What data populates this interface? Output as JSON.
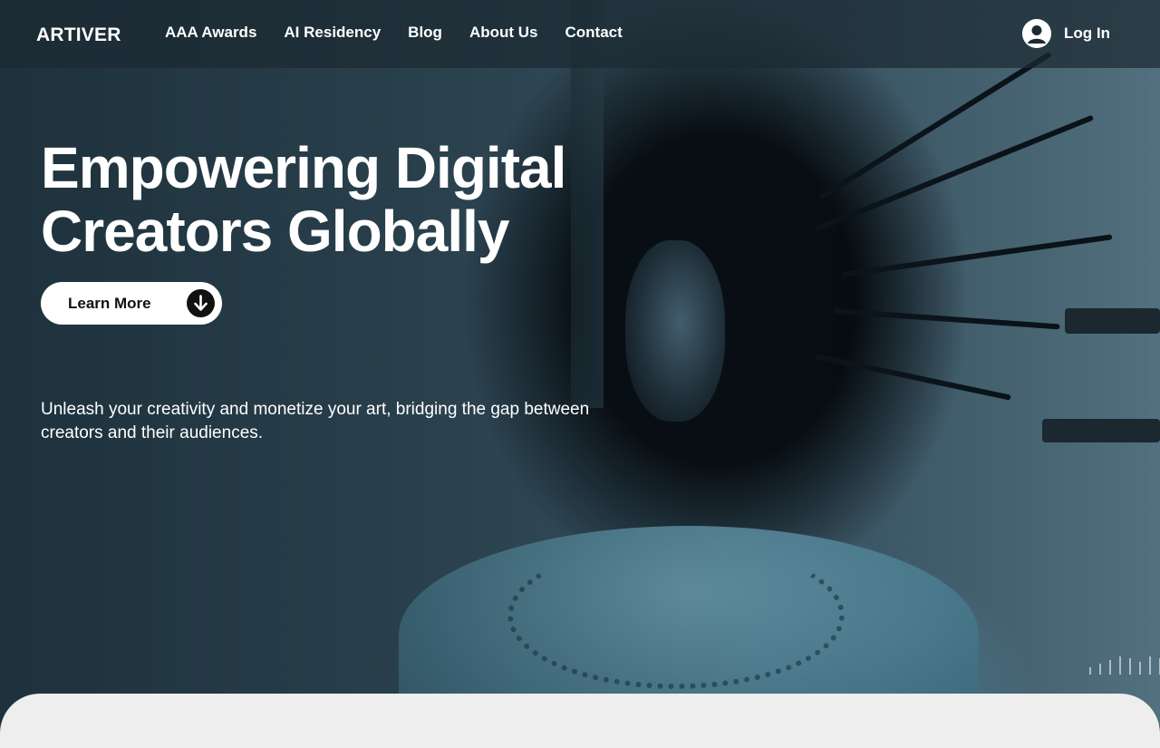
{
  "nav": {
    "logo": "ARTIVER",
    "links": [
      "AAA Awards",
      "AI Residency",
      "Blog",
      "About Us",
      "Contact"
    ],
    "login_label": "Log In",
    "login_icon": "user-circle-icon"
  },
  "hero": {
    "title_line1": "Empowering Digital",
    "title_line2": "Creators Globally",
    "cta_label": "Learn More",
    "cta_icon": "arrow-down-icon",
    "subtitle": "Unleash your creativity and monetize your art, bridging the gap between creators and their audiences."
  },
  "colors": {
    "accent_dark": "#111111",
    "text_light": "#ffffff",
    "panel": "#eeeeee"
  }
}
